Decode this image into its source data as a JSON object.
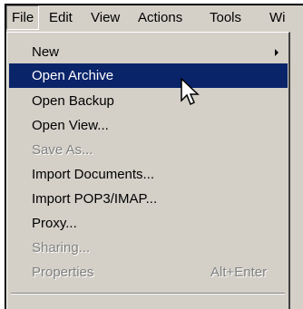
{
  "menubar": {
    "items": [
      {
        "label": "File"
      },
      {
        "label": "Edit"
      },
      {
        "label": "View"
      },
      {
        "label": "Actions"
      },
      {
        "label": "Tools"
      },
      {
        "label": "Wi"
      }
    ]
  },
  "file_menu": {
    "items": [
      {
        "label": "New",
        "shortcut": "",
        "state": "normal",
        "submenu": true
      },
      {
        "label": "Open Archive",
        "shortcut": "",
        "state": "highlighted"
      },
      {
        "label": "Open Backup",
        "shortcut": "",
        "state": "normal"
      },
      {
        "label": "Open View...",
        "shortcut": "",
        "state": "normal"
      },
      {
        "label": "Save As...",
        "shortcut": "",
        "state": "disabled"
      },
      {
        "label": "Import Documents...",
        "shortcut": "",
        "state": "normal"
      },
      {
        "label": "Import POP3/IMAP...",
        "shortcut": "",
        "state": "normal"
      },
      {
        "label": "Proxy...",
        "shortcut": "",
        "state": "normal"
      },
      {
        "label": "Sharing...",
        "shortcut": "",
        "state": "disabled"
      },
      {
        "label": "Properties",
        "shortcut": "Alt+Enter",
        "state": "disabled"
      }
    ]
  },
  "colors": {
    "menu_background": "#d4d0c8",
    "highlight": "#0a246a",
    "highlight_text": "#ffffff",
    "disabled_text": "#808080"
  },
  "icons": {
    "submenu_arrow": "chevron-right-icon",
    "pointer": "mouse-cursor-icon"
  }
}
